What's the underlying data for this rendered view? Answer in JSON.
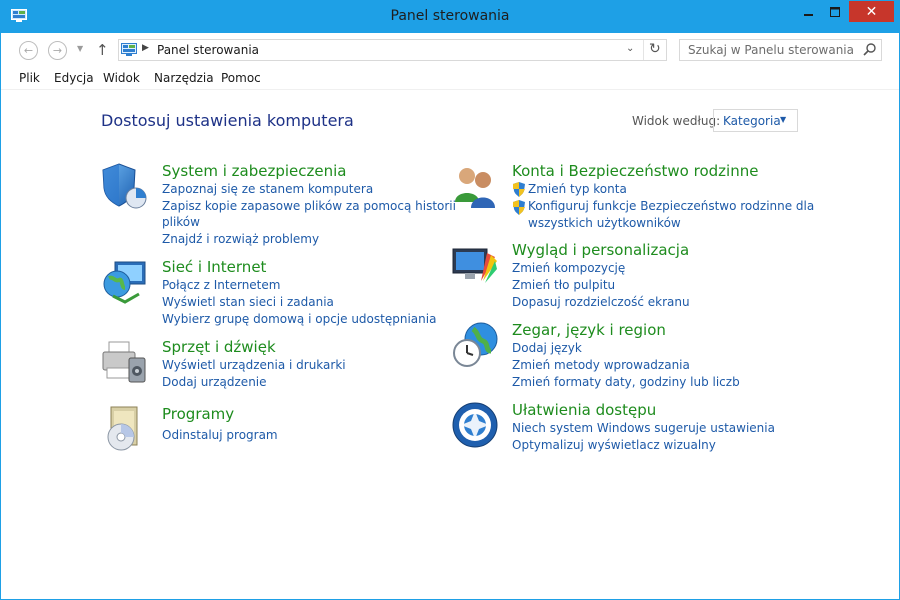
{
  "window": {
    "title": "Panel sterowania",
    "close_symbol": "✕"
  },
  "address": {
    "path": "Panel sterowania"
  },
  "search": {
    "placeholder": "Szukaj w Panelu sterowania"
  },
  "menu": [
    "Plik",
    "Edycja",
    "Widok",
    "Narzędzia",
    "Pomoc"
  ],
  "main": {
    "heading": "Dostosuj ustawienia komputera",
    "view_label": "Widok według:",
    "view_value": "Kategoria"
  },
  "categories": [
    {
      "title": "System i zabezpieczenia",
      "icon": "shield-icon",
      "links": [
        "Zapoznaj się ze stanem komputera",
        "Zapisz kopie zapasowe plików za pomocą historii",
        "plików",
        "Znajdź i rozwiąż problemy"
      ]
    },
    {
      "title": "Sieć i Internet",
      "icon": "network-globe-icon",
      "links": [
        "Połącz z Internetem",
        "Wyświetl stan sieci i zadania",
        "Wybierz grupę domową i opcje udostępniania"
      ]
    },
    {
      "title": "Sprzęt i dźwięk",
      "icon": "printer-speaker-icon",
      "links": [
        "Wyświetl urządzenia i drukarki",
        "Dodaj urządzenie"
      ]
    },
    {
      "title": "Programy",
      "icon": "programs-disc-icon",
      "links": [
        "Odinstaluj program"
      ]
    },
    {
      "title": "Konta i Bezpieczeństwo rodzinne",
      "icon": "users-icon",
      "links": [
        "Zmień typ konta",
        "Konfiguruj funkcje Bezpieczeństwo rodzinne dla",
        "wszystkich użytkowników"
      ]
    },
    {
      "title": "Wygląd i personalizacja",
      "icon": "monitor-palette-icon",
      "links": [
        "Zmień kompozycję",
        "Zmień tło pulpitu",
        "Dopasuj rozdzielczość ekranu"
      ]
    },
    {
      "title": "Zegar, język i region",
      "icon": "clock-globe-icon",
      "links": [
        "Dodaj język",
        "Zmień metody wprowadzania",
        "Zmień formaty daty, godziny lub liczb"
      ]
    },
    {
      "title": "Ułatwienia dostępu",
      "icon": "accessibility-icon",
      "links": [
        "Niech system Windows sugeruje ustawienia",
        "Optymalizuj wyświetlacz wizualny"
      ]
    }
  ]
}
